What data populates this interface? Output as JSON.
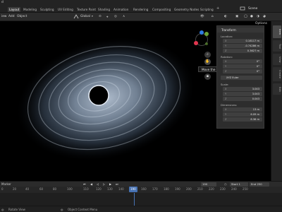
{
  "topbar": {
    "menu_first": "d",
    "scene_label": "Scene",
    "workspaces": [
      "Layout",
      "Modeling",
      "Sculpting",
      "UV Editing",
      "Texture Paint",
      "Shading",
      "Animation",
      "Rendering",
      "Compositing",
      "Geometry Nodes",
      "Scripting"
    ],
    "active_workspace": "Layout"
  },
  "header": {
    "menu_items": [
      "iew",
      "Add",
      "Object"
    ],
    "orientation": "Global",
    "options_label": "Options"
  },
  "npanel": {
    "title": "Transform",
    "location_label": "Location:",
    "location": [
      {
        "k": "X",
        "v": "0.16117 m"
      },
      {
        "k": "Y",
        "v": "-0.74286 m"
      },
      {
        "k": "Z",
        "v": "0.3627 m"
      }
    ],
    "rotation_label": "Rotation:",
    "rotation": [
      {
        "k": "X",
        "v": "0°"
      },
      {
        "k": "Y",
        "v": "0°"
      },
      {
        "k": "Z",
        "v": "0°"
      }
    ],
    "rotation_mode": "XYZ Euler",
    "scale_label": "Scale:",
    "scale": [
      {
        "k": "X",
        "v": "3.043"
      },
      {
        "k": "Y",
        "v": "3.043"
      },
      {
        "k": "Z",
        "v": "0.043"
      }
    ],
    "dimensions_label": "Dimensions:",
    "dimensions": [
      {
        "k": "X",
        "v": "13 m"
      },
      {
        "k": "Y",
        "v": "6.09 m"
      },
      {
        "k": "Z",
        "v": "8.36 m"
      }
    ],
    "tabs": [
      "Item",
      "Tool",
      "View",
      "Create",
      "Edit"
    ]
  },
  "tooltip": {
    "text": "Move the view"
  },
  "gizmo": {
    "x_label": "X",
    "y_label": "Y",
    "z_label": "Z",
    "colors": {
      "x": "#e2364f",
      "y": "#6ba335",
      "z": "#2f7be0"
    }
  },
  "timeline": {
    "marker_label": "Marker",
    "current_frame": "190",
    "start_label": "Start",
    "start_value": "1",
    "end_label": "End",
    "end_value": "250",
    "ticks": [
      "0",
      "20",
      "40",
      "60",
      "80",
      "100",
      "110",
      "120",
      "130",
      "140",
      "150",
      "160",
      "170",
      "180",
      "190",
      "200",
      "210",
      "220",
      "230",
      "240",
      "250"
    ],
    "playhead_label": "190",
    "accent": "#4772b3"
  },
  "statusbar": {
    "left": "Rotate View",
    "right": "Object Context Menu"
  }
}
